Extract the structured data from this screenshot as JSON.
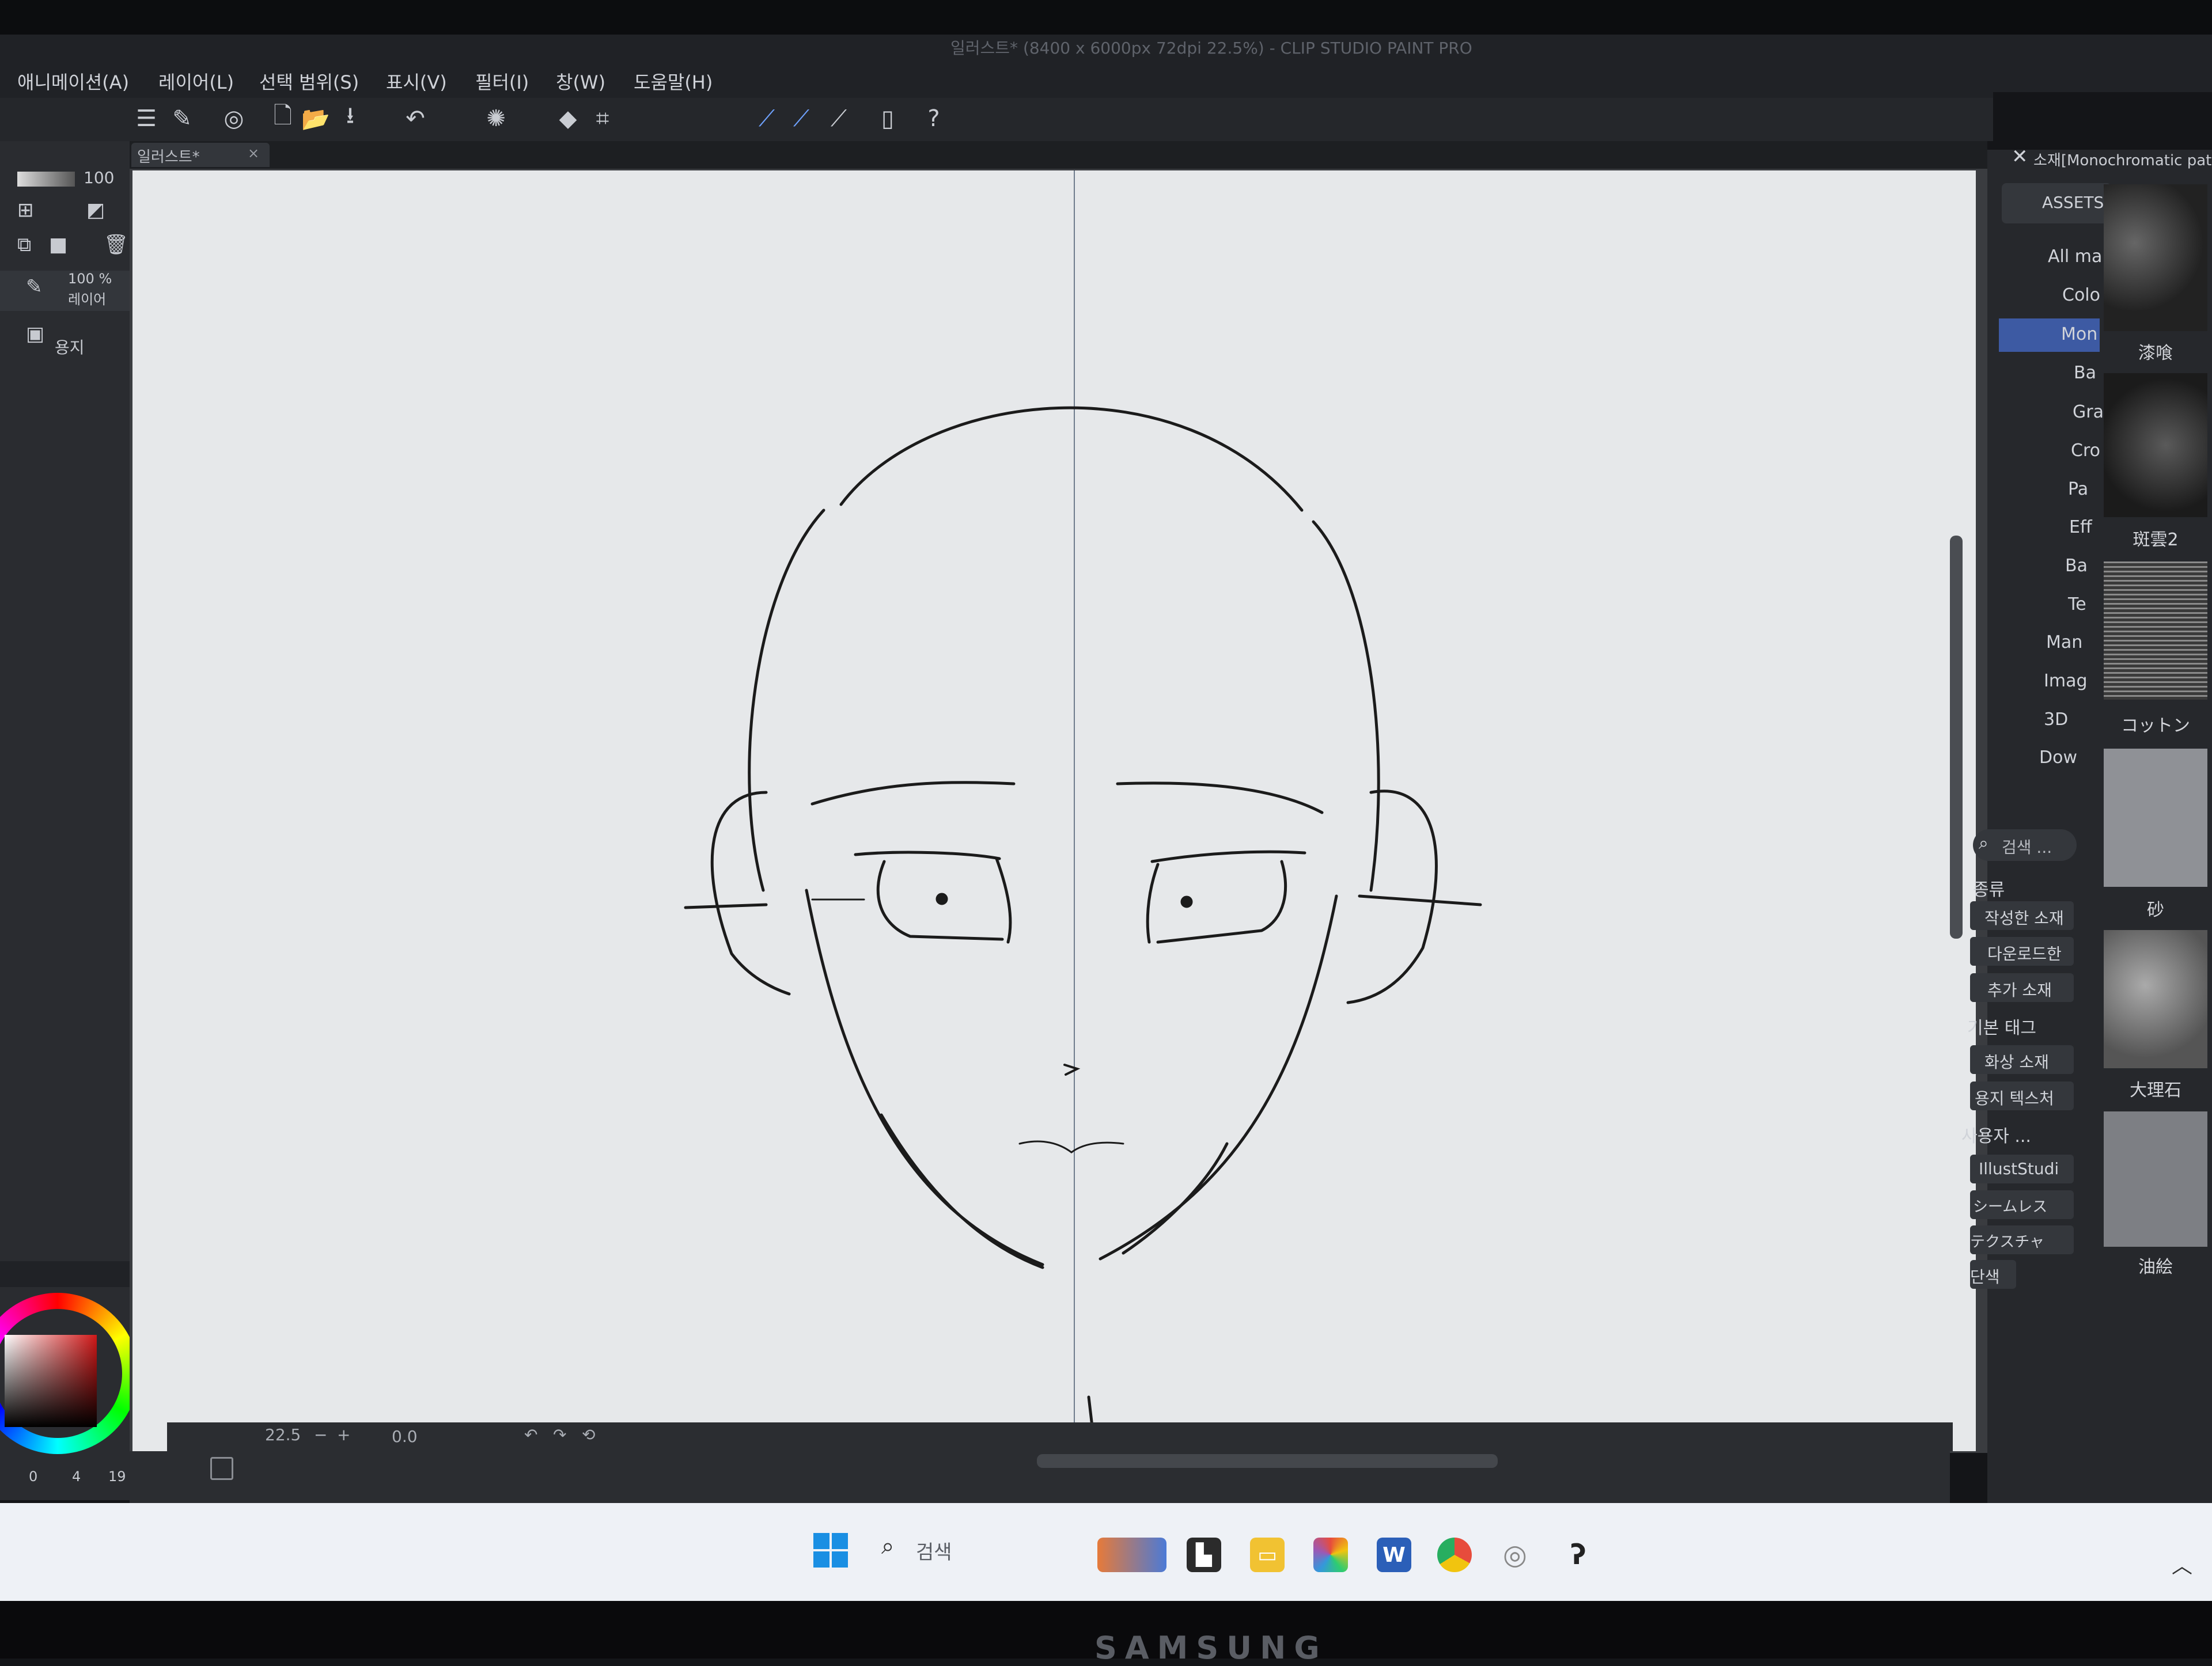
{
  "window": {
    "title": "일러스트* (8400 x 6000px 72dpi 22.5%) - CLIP STUDIO PAINT PRO"
  },
  "menu": {
    "items": [
      "애니메이션(A)",
      "레이어(L)",
      "선택 범위(S)",
      "표시(V)",
      "필터(I)",
      "창(W)",
      "도움말(H)"
    ]
  },
  "document": {
    "tab_label": "일러스트*",
    "close_glyph": "×"
  },
  "layer_panel": {
    "opacity_top": "100",
    "opacity_layer": "100 %",
    "blend_mode": "레이어",
    "paper_layer": "용지"
  },
  "status_bar": {
    "zoom": "22.5",
    "rotation": "0.0"
  },
  "color_panel": {
    "counts": "0",
    "count2": "4",
    "count3": "19"
  },
  "assets": {
    "header": "소재[Monochromatic pattern]",
    "tab_label": "ASSETS",
    "tree": [
      "All ma",
      "Colo",
      "Mon",
      "Ba",
      "Gra",
      "Cro",
      "Pa",
      "Eff",
      "Ba",
      "Te",
      "Man",
      "Imag",
      "3D",
      "Dow"
    ],
    "search_placeholder": "검색 ...",
    "kind_label": "종류",
    "filters": [
      "작성한 소재",
      "다운로드한",
      "추가 소재",
      "기본 태그",
      "화상 소재",
      "용지 텍스처",
      "사용자 ...",
      "IllustStudi",
      "シームレス",
      "テクスチャ",
      "단색"
    ],
    "swatches": [
      "漆喰",
      "斑雲2",
      "コットン",
      "砂",
      "大理石",
      "油絵"
    ]
  },
  "taskbar": {
    "search_label": "검색"
  }
}
